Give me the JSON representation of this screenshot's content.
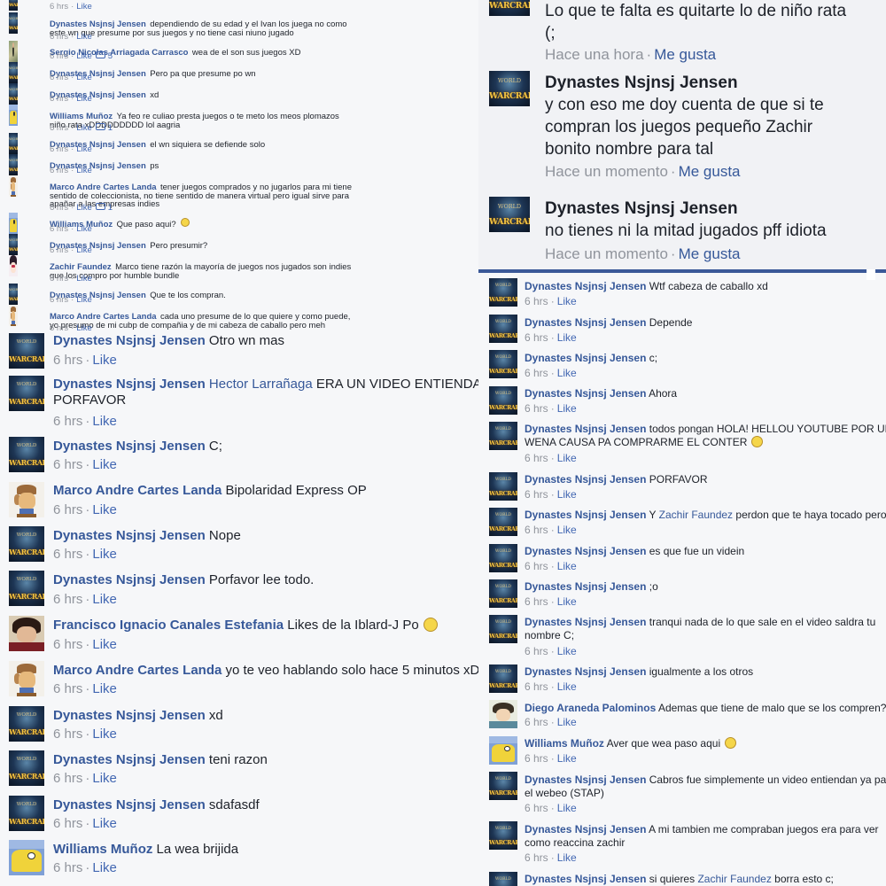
{
  "ui": {
    "like": "Like",
    "me_gusta": "Me gusta",
    "separator": "·"
  },
  "left_top": {
    "comments": [
      {
        "author": "",
        "text": "",
        "time": "6 hrs",
        "likes": ""
      },
      {
        "author": "Dynastes Nsjnsj Jensen",
        "text": "dependiendo de su edad y el Ivan los juega no como",
        "text2": "este wn que presume por sus juegos y no tiene casi niuno jugado",
        "time": "6 hrs",
        "likes": ""
      },
      {
        "author": "Sergio Nicolas Arriagada Carrasco",
        "text": "wea de el son sus juegos XD",
        "time": "6 hrs",
        "likes": "5"
      },
      {
        "author": "Dynastes Nsjnsj Jensen",
        "text": "Pero pa que presume po wn",
        "time": "6 hrs",
        "likes": ""
      },
      {
        "author": "Dynastes Nsjnsj Jensen",
        "text": "xd",
        "time": "6 hrs",
        "likes": ""
      },
      {
        "author": "Williams Muñoz",
        "text": "Ya feo re culiao presta juegos o te meto los meos plomazos",
        "text2": "niño rata xDDDDDDDDD lol aagria",
        "time": "6 hrs",
        "likes": "1"
      },
      {
        "author": "Dynastes Nsjnsj Jensen",
        "text": "el wn siquiera se defiende solo",
        "time": "6 hrs",
        "likes": ""
      },
      {
        "author": "Dynastes Nsjnsj Jensen",
        "text": "ps",
        "time": "6 hrs",
        "likes": ""
      },
      {
        "author": "Marco Andre Cartes Landa",
        "text": "tener juegos comprados y no jugarlos para mi tiene",
        "text2": "sentido de coleccionista, no tiene sentido de manera virtual pero igual sirve para",
        "text3": "apañar a las empresas indies",
        "time": "6 hrs",
        "likes": "1"
      },
      {
        "author": "Williams Muñoz",
        "text": "Que paso aqui?",
        "time": "6 hrs",
        "likes": ""
      },
      {
        "author": "Dynastes Nsjnsj Jensen",
        "text": "Pero presumir?",
        "time": "6 hrs",
        "likes": ""
      },
      {
        "author": "Zachir Faundez",
        "text": "Marco tiene razón la mayoría de juegos nos jugados son indies",
        "text2": "que los compro por humble bundle",
        "time": "6 hrs",
        "likes": ""
      },
      {
        "author": "Dynastes Nsjnsj Jensen",
        "text": "Que te los compran.",
        "time": "6 hrs",
        "likes": ""
      },
      {
        "author": "Marco Andre Cartes Landa",
        "text": "cada uno presume de lo que quiere y como puede,",
        "text2": "yo presumo de mi cubp de compañia y de mi cabeza de caballo pero meh",
        "time": "6 hrs",
        "likes": ""
      }
    ]
  },
  "left_bottom": {
    "comments": [
      {
        "author": "Dynastes Nsjnsj Jensen",
        "text": "Otro wn mas",
        "time": "6 hrs"
      },
      {
        "author": "Dynastes Nsjnsj Jensen",
        "mention": "Hector Larrañaga",
        "text": "ERA UN VIDEO ENTIENDAN",
        "text2": "PORFAVOR",
        "time": "6 hrs"
      },
      {
        "author": "Dynastes Nsjnsj Jensen",
        "text": "C;",
        "time": "6 hrs"
      },
      {
        "author": "Marco Andre Cartes Landa",
        "text": "Bipolaridad Express OP",
        "time": "6 hrs"
      },
      {
        "author": "Dynastes Nsjnsj Jensen",
        "text": "Nope",
        "time": "6 hrs"
      },
      {
        "author": "Dynastes Nsjnsj Jensen",
        "text": "Porfavor lee todo.",
        "time": "6 hrs"
      },
      {
        "author": "Francisco Ignacio Canales Estefania",
        "text": "Likes de la Iblard-J Po",
        "time": "6 hrs"
      },
      {
        "author": "Marco Andre Cartes Landa",
        "text": "yo te veo hablando solo hace 5 minutos xD",
        "time": "6 hrs"
      },
      {
        "author": "Dynastes Nsjnsj Jensen",
        "text": "xd",
        "time": "6 hrs"
      },
      {
        "author": "Dynastes Nsjnsj Jensen",
        "text": "teni razon",
        "time": "6 hrs"
      },
      {
        "author": "Dynastes Nsjnsj Jensen",
        "text": "sdafasdf",
        "time": "6 hrs"
      },
      {
        "author": "Williams Muñoz",
        "text": "La wea brijida",
        "time": "6 hrs"
      }
    ]
  },
  "right_top": {
    "comments": [
      {
        "author": "",
        "text": "Lo que te falta es quitarte lo de niño rata",
        "text2": "(;",
        "time": "Hace una hora"
      },
      {
        "author": "Dynastes Nsjnsj Jensen",
        "text": "y con eso me doy cuenta de que si te",
        "text2": "compran los juegos pequeño Zachir",
        "text3": "bonito nombre para tal",
        "time": "Hace un momento"
      },
      {
        "author": "Dynastes Nsjnsj Jensen",
        "text": "no tienes ni la mitad jugados pff idiota",
        "time": "Hace un momento"
      }
    ]
  },
  "right_bottom": {
    "comments": [
      {
        "author": "Dynastes Nsjnsj Jensen",
        "text": "Wtf cabeza de caballo xd",
        "time": "6 hrs"
      },
      {
        "author": "Dynastes Nsjnsj Jensen",
        "text": "Depende",
        "time": "6 hrs"
      },
      {
        "author": "Dynastes Nsjnsj Jensen",
        "text": "c;",
        "time": "6 hrs"
      },
      {
        "author": "Dynastes Nsjnsj Jensen",
        "text": "Ahora",
        "time": "6 hrs"
      },
      {
        "author": "Dynastes Nsjnsj Jensen",
        "text": "todos pongan HOLA! HELLOU YOUTUBE POR UN",
        "text2": "WENA CAUSA PA COMPRARME EL CONTER",
        "time": "6 hrs"
      },
      {
        "author": "Dynastes Nsjnsj Jensen",
        "text": "PORFAVOR",
        "time": "6 hrs"
      },
      {
        "author": "Dynastes Nsjnsj Jensen",
        "text_pre": "Y",
        "mention": "Zachir Faundez",
        "text": "perdon que te haya tocado pero",
        "time": "6 hrs"
      },
      {
        "author": "Dynastes Nsjnsj Jensen",
        "text": "es que fue un videin",
        "time": "6 hrs"
      },
      {
        "author": "Dynastes Nsjnsj Jensen",
        "text": ";o",
        "time": "6 hrs"
      },
      {
        "author": "Dynastes Nsjnsj Jensen",
        "text": "tranqui nada de lo que sale en el video saldra tu",
        "text2": "nombre C;",
        "time": "6 hrs"
      },
      {
        "author": "Dynastes Nsjnsj Jensen",
        "text": "igualmente a los otros",
        "time": "6 hrs"
      },
      {
        "author": "Diego Araneda Palominos",
        "text": "Ademas que tiene de malo que se los compren? x",
        "time": "6 hrs"
      },
      {
        "author": "Williams Muñoz",
        "text": "Aver que wea paso aqui",
        "time": "6 hrs"
      },
      {
        "author": "Dynastes Nsjnsj Jensen",
        "text": "Cabros fue simplemente un video entiendan ya pare",
        "text2": "el webeo (STAP)",
        "time": "6 hrs"
      },
      {
        "author": "Dynastes Nsjnsj Jensen",
        "text": "A mi tambien me compraban juegos era para ver",
        "text2": "como reaccina zachir",
        "time": "6 hrs"
      },
      {
        "author": "Dynastes Nsjnsj Jensen",
        "text": "si quieres",
        "mention": "Zachir Faundez",
        "text_post": "borra esto c;",
        "time": ""
      }
    ]
  },
  "avatar_logo": {
    "small": "WORLD",
    "big": "WARCRAFT"
  }
}
